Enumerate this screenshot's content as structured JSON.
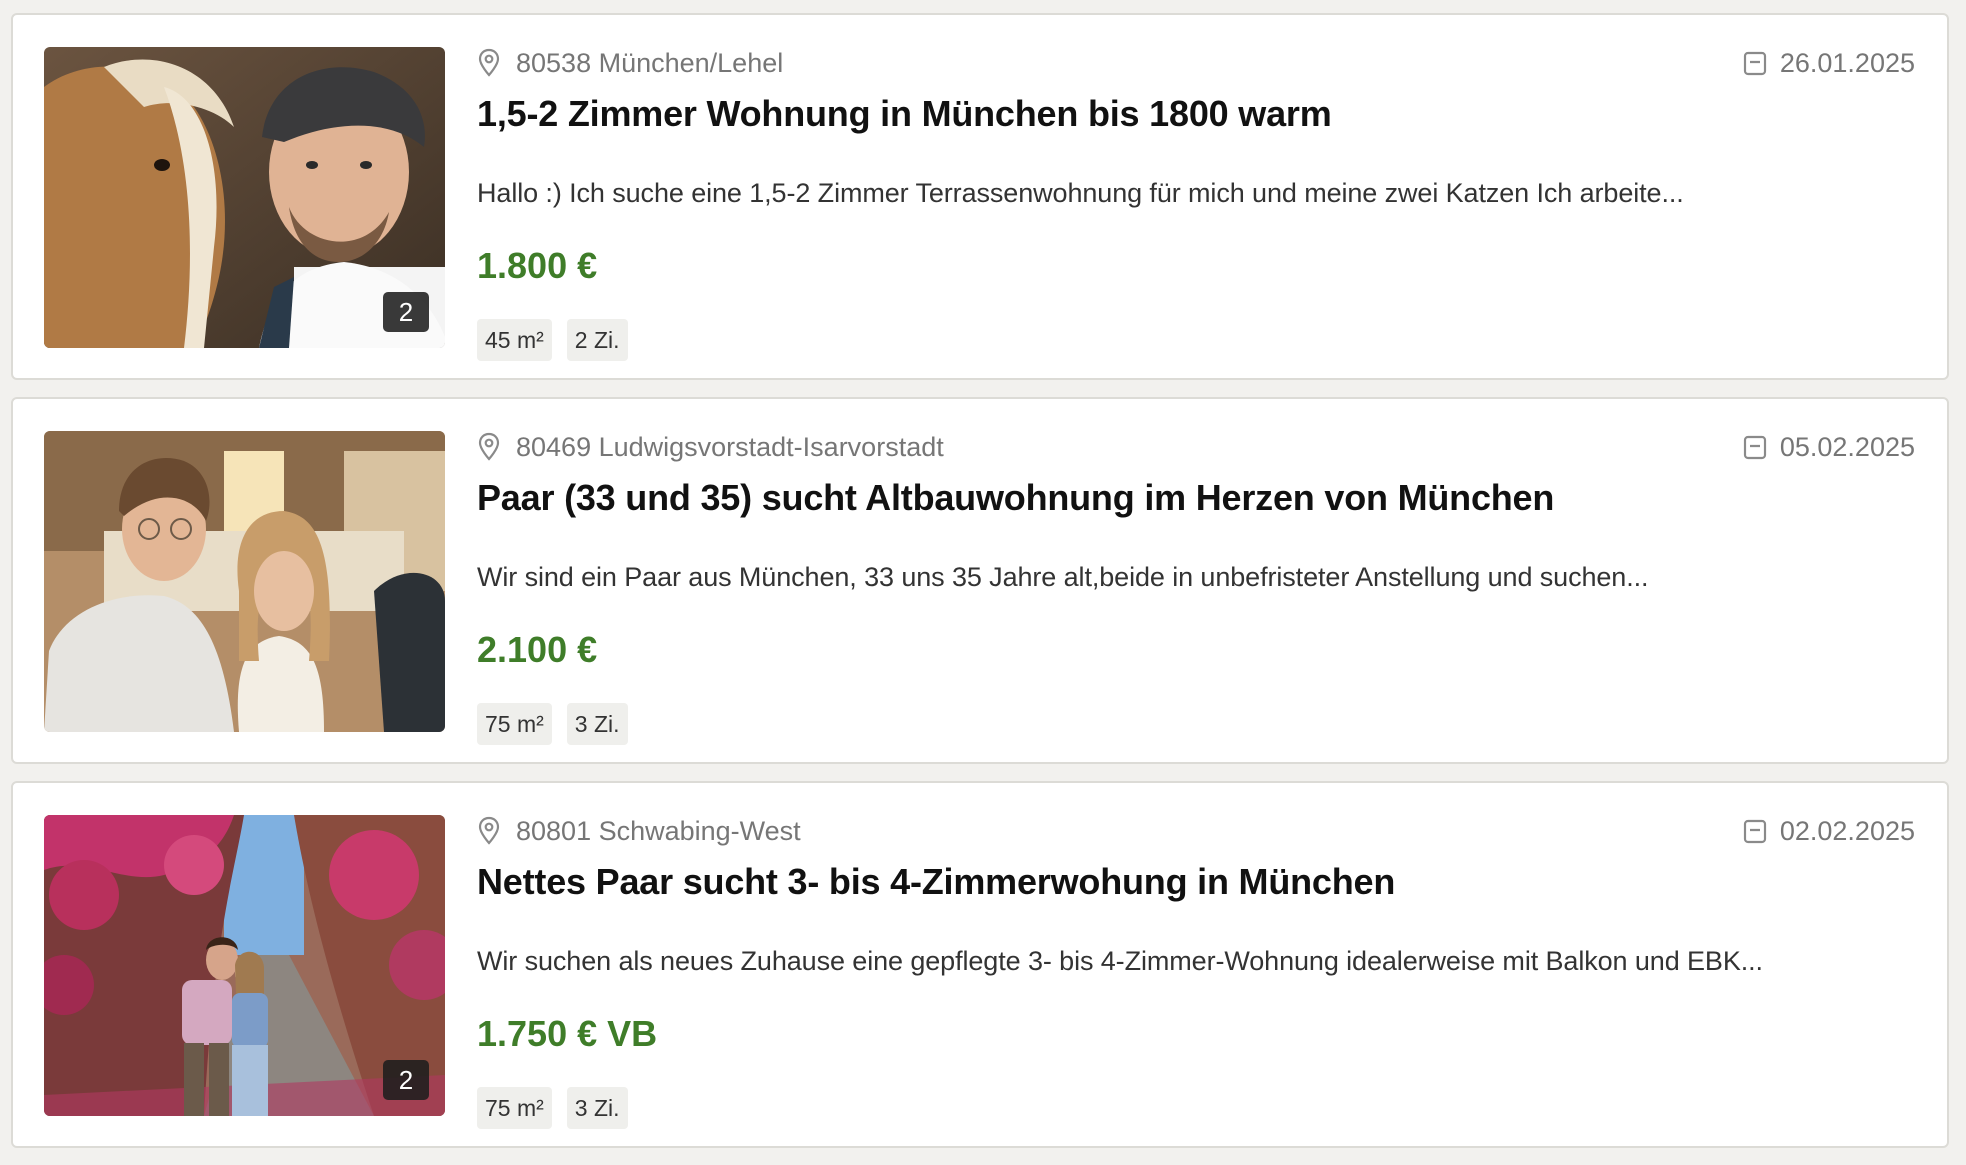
{
  "listings": [
    {
      "location": "80538 München/Lehel",
      "date": "26.01.2025",
      "title": "1,5-2 Zimmer Wohnung in München bis 1800 warm",
      "description": "Hallo :) Ich suche eine 1,5-2 Zimmer Terrassenwohnung für mich und meine zwei Katzen Ich arbeite...",
      "price": "1.800 €",
      "size": "45 m²",
      "rooms": "2 Zi.",
      "image_count": "2"
    },
    {
      "location": "80469 Ludwigsvorstadt-Isarvorstadt",
      "date": "05.02.2025",
      "title": "Paar (33 und 35) sucht Altbauwohnung im Herzen von München",
      "description": "Wir sind ein Paar aus München, 33 uns 35 Jahre alt,beide in unbefristeter Anstellung und suchen...",
      "price": "2.100 €",
      "size": "75 m²",
      "rooms": "3 Zi."
    },
    {
      "location": "80801 Schwabing-West",
      "date": "02.02.2025",
      "title": "Nettes Paar sucht 3- bis 4-Zimmerwohung in München",
      "description": "Wir suchen als neues Zuhause eine gepflegte 3- bis 4-Zimmer-Wohnung idealerweise mit Balkon und EBK...",
      "price": "1.750 € VB",
      "size": "75 m²",
      "rooms": "3 Zi.",
      "image_count": "2"
    }
  ],
  "icons": {
    "location": "map-pin-icon",
    "date": "calendar-icon"
  },
  "colors": {
    "price": "#3f7d29",
    "background": "#f2f1ee",
    "card": "#ffffff",
    "meta_text": "#767676"
  }
}
